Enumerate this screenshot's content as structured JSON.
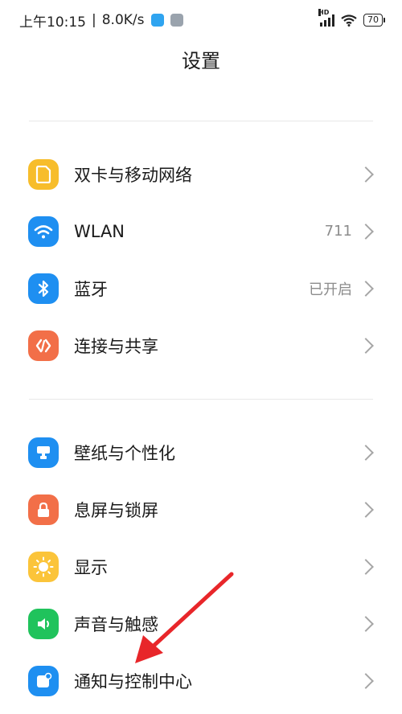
{
  "status_bar": {
    "time": "上午10:15",
    "separator": "|",
    "network_speed": "8.0K/s",
    "network_type": "HD",
    "battery": "70"
  },
  "page": {
    "title": "设置"
  },
  "groups": [
    {
      "items": [
        {
          "label": "双卡与移动网络",
          "value": "",
          "icon": "sim-card-icon",
          "color": "#f7bd2b"
        },
        {
          "label": "WLAN",
          "value": "711",
          "icon": "wifi-icon",
          "color": "#1e8ff1"
        },
        {
          "label": "蓝牙",
          "value": "已开启",
          "icon": "bluetooth-icon",
          "color": "#1e8ff1"
        },
        {
          "label": "连接与共享",
          "value": "",
          "icon": "share-connection-icon",
          "color": "#f26f48"
        }
      ]
    },
    {
      "items": [
        {
          "label": "壁纸与个性化",
          "value": "",
          "icon": "wallpaper-icon",
          "color": "#1e8ff1"
        },
        {
          "label": "息屏与锁屏",
          "value": "",
          "icon": "lock-icon",
          "color": "#f26f48"
        },
        {
          "label": "显示",
          "value": "",
          "icon": "sun-icon",
          "color": "#fbc43a"
        },
        {
          "label": "声音与触感",
          "value": "",
          "icon": "speaker-icon",
          "color": "#20c35c"
        },
        {
          "label": "通知与控制中心",
          "value": "",
          "icon": "notification-icon",
          "color": "#1e8ff1"
        }
      ]
    }
  ],
  "annotation": {
    "type": "red-arrow",
    "points_to": "通知与控制中心",
    "color": "#e8262a"
  }
}
